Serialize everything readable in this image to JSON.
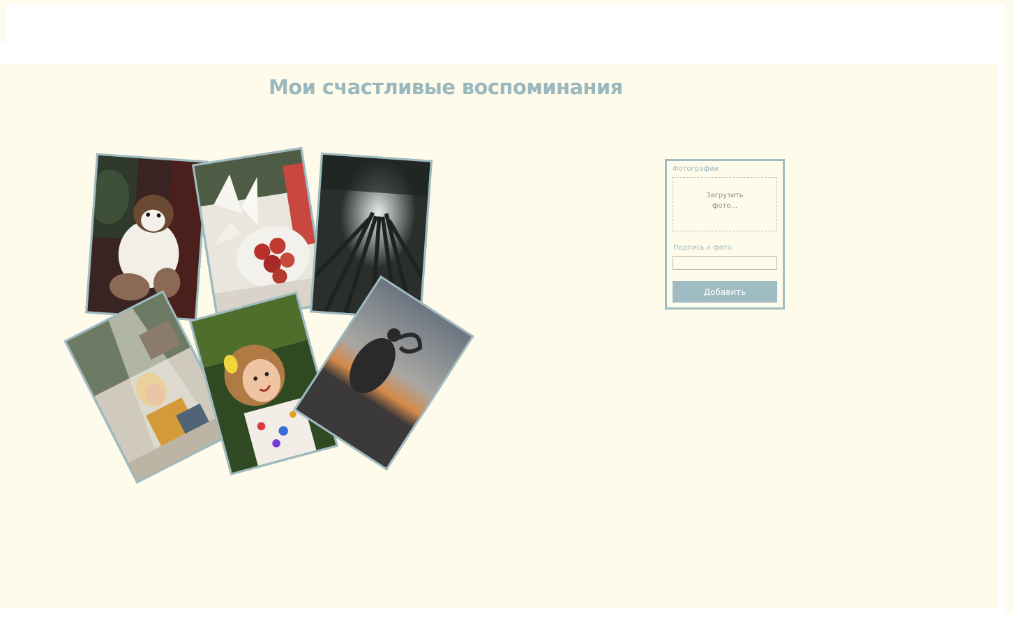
{
  "page": {
    "title": "Мои счастливые воспоминания"
  },
  "colors": {
    "background": "#fefbea",
    "accent": "#9fbcc2",
    "title": "#9bb8be",
    "button_text": "#ffffff"
  },
  "gallery": {
    "photos": [
      {
        "subject": "puppy held in hands"
      },
      {
        "subject": "lilies and peaches on a plate"
      },
      {
        "subject": "forest trees from below"
      },
      {
        "subject": "smiling woman in sunlight"
      },
      {
        "subject": "child with paint-covered face"
      },
      {
        "subject": "silhouette making heart at sunset"
      }
    ]
  },
  "form": {
    "photos_label": "Фотографии",
    "upload_text": "Загрузить фото...",
    "caption_label": "Подпись к фото",
    "caption_value": "",
    "add_button": "Добавить"
  }
}
